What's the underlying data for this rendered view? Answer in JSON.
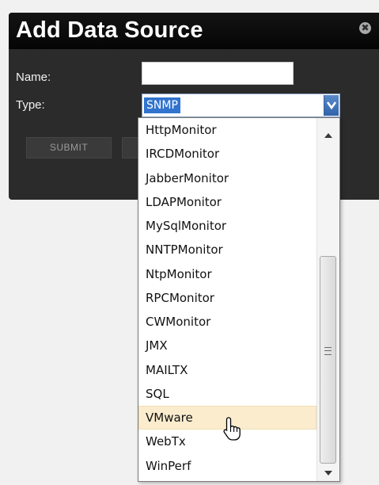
{
  "dialog": {
    "title": "Add Data Source",
    "close_glyph": "✖",
    "name_label": "Name:",
    "name_value": "",
    "type_label": "Type:",
    "type_selected": "SNMP",
    "submit_label": "SUBMIT",
    "cancel_label": ""
  },
  "dropdown": {
    "options": [
      "HttpMonitor",
      "IRCDMonitor",
      "JabberMonitor",
      "LDAPMonitor",
      "MySqlMonitor",
      "NNTPMonitor",
      "NtpMonitor",
      "RPCMonitor",
      "CWMonitor",
      "JMX",
      "MAILTX",
      "SQL",
      "VMware",
      "WebTx",
      "WinPerf"
    ],
    "highlighted_option": "VMware"
  },
  "icons": {
    "close": "close-icon",
    "select_arrow": "chevron-down-icon",
    "scroll_up": "scroll-up-arrow-icon",
    "scroll_down": "scroll-down-arrow-icon",
    "cursor": "hand-pointer-cursor-icon"
  },
  "colors": {
    "dialog_bg": "#2b2b2b",
    "header_bg": "#050505",
    "selection": "#3173cf",
    "hover": "#fbeccd"
  }
}
